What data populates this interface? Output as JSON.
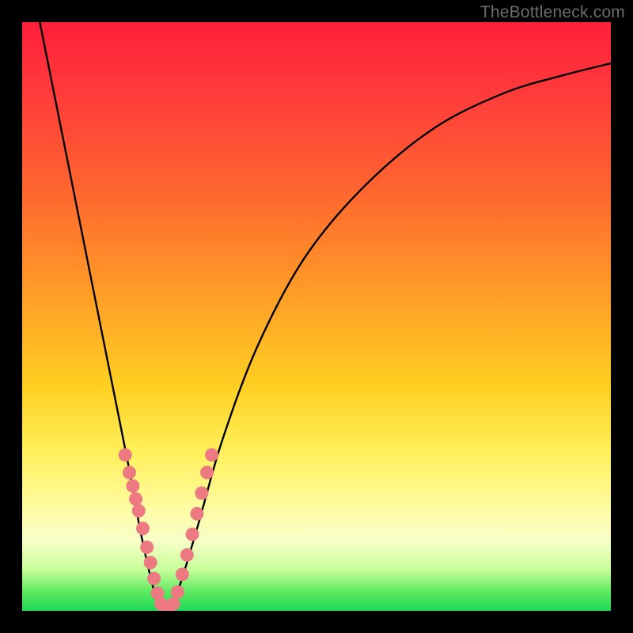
{
  "watermark": "TheBottleneck.com",
  "colors": {
    "curve_stroke": "#000000",
    "marker_fill": "#ed7a82",
    "marker_stroke": "#d46069",
    "background_black": "#000000"
  },
  "chart_data": {
    "type": "line",
    "title": "",
    "xlabel": "",
    "ylabel": "",
    "xlim": [
      0,
      1
    ],
    "ylim": [
      0,
      1
    ],
    "note": "No axes or tick labels are visible; x and y are normalized to the plot area (0 = left/bottom, 1 = right/top). Curve shows a deep V reaching 0 near x≈0.24, rising steeply on both sides.",
    "series": [
      {
        "name": "bottleneck-curve",
        "x": [
          0.03,
          0.06,
          0.09,
          0.12,
          0.15,
          0.18,
          0.2,
          0.22,
          0.235,
          0.25,
          0.27,
          0.3,
          0.34,
          0.4,
          0.48,
          0.58,
          0.7,
          0.82,
          0.92,
          1.0
        ],
        "y": [
          1.0,
          0.85,
          0.7,
          0.55,
          0.4,
          0.25,
          0.14,
          0.05,
          0.0,
          0.0,
          0.05,
          0.15,
          0.29,
          0.45,
          0.6,
          0.72,
          0.82,
          0.88,
          0.91,
          0.93
        ]
      }
    ],
    "markers": {
      "name": "highlighted-points",
      "comment": "Pink bead-like markers clustered along both legs of the V near the bottom.",
      "points": [
        {
          "x": 0.175,
          "y": 0.265
        },
        {
          "x": 0.182,
          "y": 0.235
        },
        {
          "x": 0.188,
          "y": 0.212
        },
        {
          "x": 0.193,
          "y": 0.19
        },
        {
          "x": 0.198,
          "y": 0.17
        },
        {
          "x": 0.205,
          "y": 0.14
        },
        {
          "x": 0.212,
          "y": 0.108
        },
        {
          "x": 0.218,
          "y": 0.082
        },
        {
          "x": 0.224,
          "y": 0.055
        },
        {
          "x": 0.23,
          "y": 0.03
        },
        {
          "x": 0.236,
          "y": 0.012
        },
        {
          "x": 0.243,
          "y": 0.003
        },
        {
          "x": 0.25,
          "y": 0.003
        },
        {
          "x": 0.257,
          "y": 0.012
        },
        {
          "x": 0.264,
          "y": 0.032
        },
        {
          "x": 0.272,
          "y": 0.062
        },
        {
          "x": 0.28,
          "y": 0.095
        },
        {
          "x": 0.289,
          "y": 0.13
        },
        {
          "x": 0.297,
          "y": 0.165
        },
        {
          "x": 0.305,
          "y": 0.2
        },
        {
          "x": 0.314,
          "y": 0.235
        },
        {
          "x": 0.322,
          "y": 0.265
        }
      ]
    }
  }
}
